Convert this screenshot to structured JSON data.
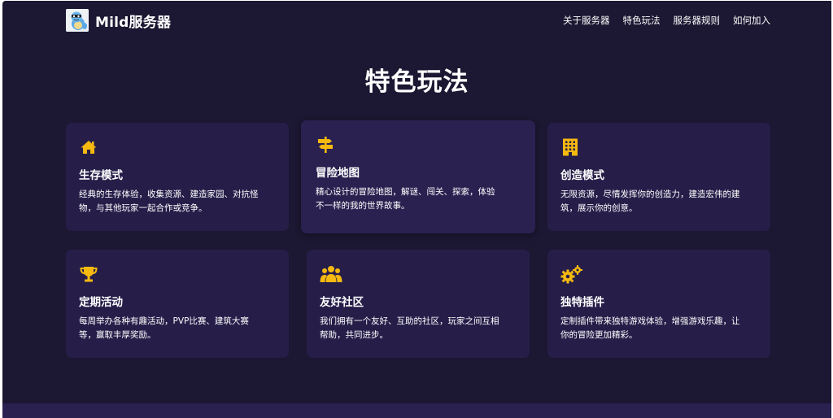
{
  "brand": {
    "name": "Mild服务器",
    "logo_icon": "squirtle-mascot-icon"
  },
  "nav": {
    "items": [
      {
        "label": "关于服务器"
      },
      {
        "label": "特色玩法"
      },
      {
        "label": "服务器规则"
      },
      {
        "label": "如何加入"
      }
    ]
  },
  "section": {
    "title": "特色玩法"
  },
  "colors": {
    "background": "#1c1732",
    "card": "#261e49",
    "accent": "#f6b90f",
    "text": "#ffffff"
  },
  "cards": [
    {
      "icon": "home-icon",
      "title": "生存模式",
      "desc_1": "经典的生存体验，收集资源、建造家园、对抗怪",
      "desc_2": "物，与其他玩家一起合作或竞争。"
    },
    {
      "icon": "signpost-icon",
      "title": "冒险地图",
      "desc_1": "精心设计的冒险地图，解谜、闯关、探索，体验",
      "desc_2": "不一样的我的世界故事。"
    },
    {
      "icon": "building-icon",
      "title": "创造模式",
      "desc_1": "无限资源，尽情发挥你的创造力，建造宏伟的建",
      "desc_2": "筑，展示你的创意。"
    },
    {
      "icon": "trophy-icon",
      "title": "定期活动",
      "desc_1": "每周举办各种有趣活动，PVP比赛、建筑大赛",
      "desc_2": "等，赢取丰厚奖励。"
    },
    {
      "icon": "users-icon",
      "title": "友好社区",
      "desc_1": "我们拥有一个友好、互助的社区，玩家之间互相",
      "desc_2": "帮助，共同进步。"
    },
    {
      "icon": "gears-icon",
      "title": "独特插件",
      "desc_1": "定制插件带来独特游戏体验，增强游戏乐趣，让",
      "desc_2": "你的冒险更加精彩。"
    }
  ]
}
